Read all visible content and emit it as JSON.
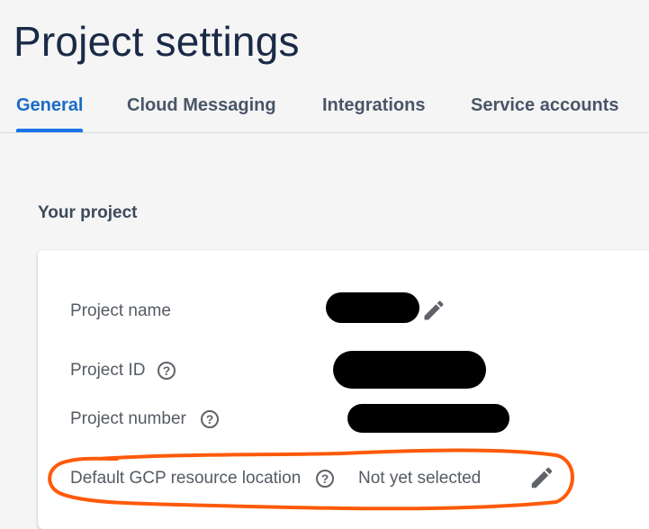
{
  "page": {
    "title": "Project settings"
  },
  "tabs": [
    {
      "label": "General",
      "active": true
    },
    {
      "label": "Cloud Messaging",
      "active": false
    },
    {
      "label": "Integrations",
      "active": false
    },
    {
      "label": "Service accounts",
      "active": false
    }
  ],
  "section": {
    "heading": "Your project"
  },
  "fields": {
    "project_name": {
      "label": "Project name"
    },
    "project_id": {
      "label": "Project ID"
    },
    "project_number": {
      "label": "Project number"
    },
    "gcp_location": {
      "label": "Default GCP resource location",
      "value": "Not yet selected"
    }
  },
  "icons": {
    "help": "?",
    "edit": "pencil-icon"
  },
  "colors": {
    "accent": "#1a73e8",
    "annotation": "#ff5a0a",
    "redaction": "#000000"
  }
}
